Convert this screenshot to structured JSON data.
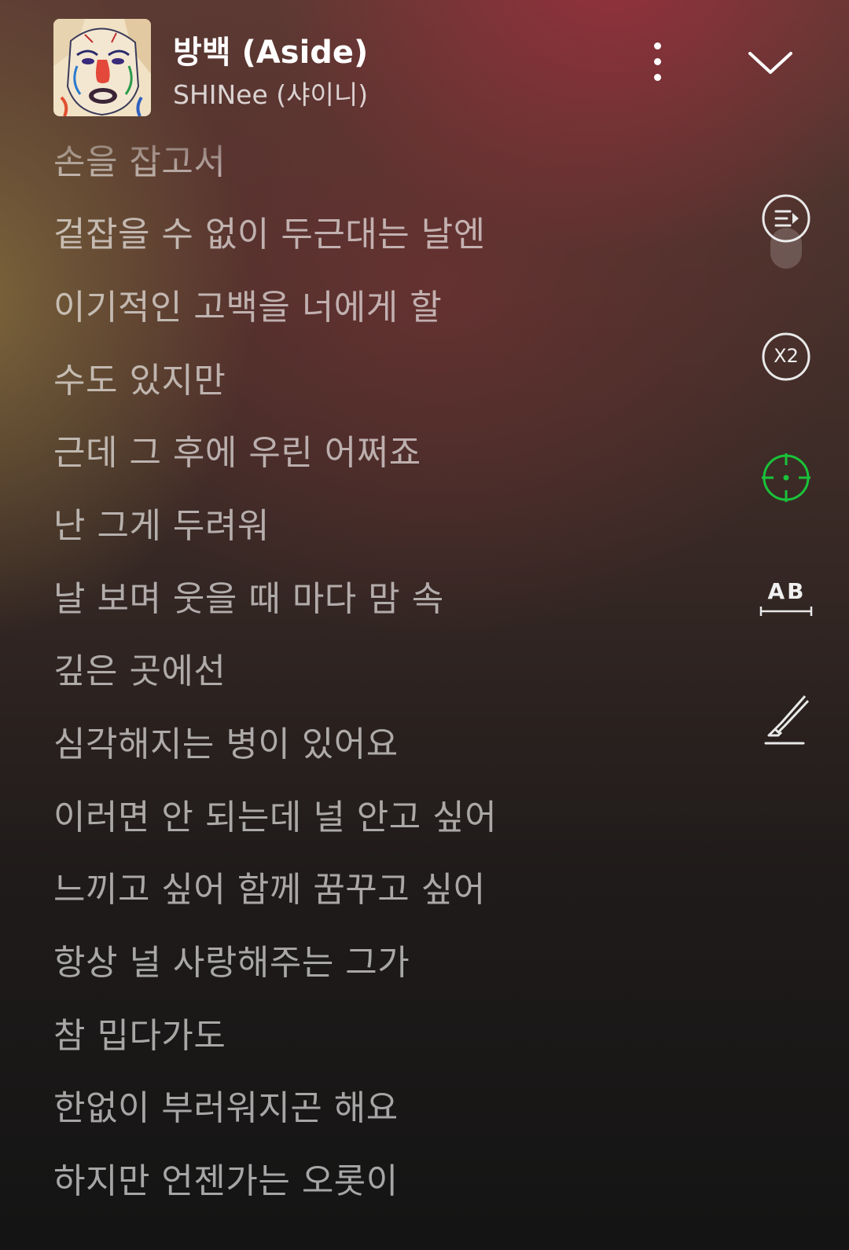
{
  "now_playing": {
    "title": "방백 (Aside)",
    "artist": "SHINee (샤이니)"
  },
  "header_icons": {
    "more": "more-vertical-icon",
    "collapse": "chevron-down-icon"
  },
  "lyrics": [
    "손을 잡고서",
    "겉잡을 수 없이 두근대는 날엔",
    "이기적인 고백을 너에게 할",
    "수도 있지만",
    "근데 그 후에 우린 어쩌죠",
    "난 그게 두려워",
    "날 보며 웃을 때 마다 맘 속",
    "깊은 곳에선",
    "심각해지는 병이 있어요",
    "이러면 안 되는데 널 안고 싶어",
    "느끼고 싶어 함께 꿈꾸고 싶어",
    "항상 널 사랑해주는 그가",
    "참 밉다가도",
    "한없이 부러워지곤 해요",
    "하지만 언젠가는 오롯이"
  ],
  "side_tools": {
    "playlist": "playlist-play-icon",
    "speed_label": "X2",
    "locate": "crosshair-icon",
    "font_size_label": "AB",
    "font_size": "font-size-icon",
    "highlight": "highlighter-icon"
  },
  "colors": {
    "accent_green": "#19c33a",
    "text": "#ffffff"
  }
}
